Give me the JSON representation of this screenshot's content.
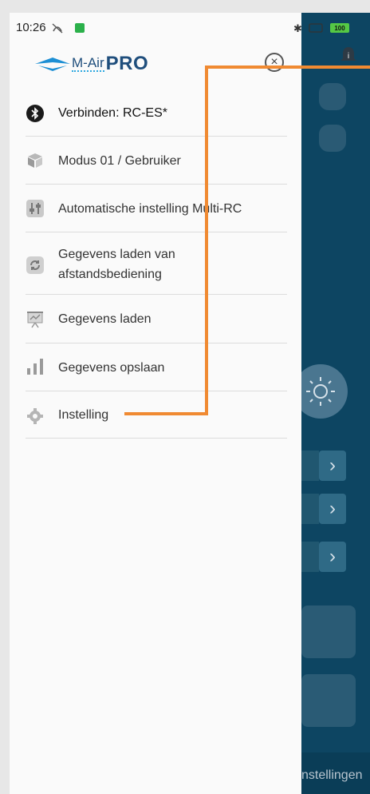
{
  "status_bar": {
    "time": "10:26",
    "battery": "100"
  },
  "drawer": {
    "logo": {
      "brand": "M-Air",
      "suffix": "PRO"
    },
    "items": [
      {
        "label": "Verbinden: RC-ES*",
        "icon": "bluetooth-icon"
      },
      {
        "label": "Modus 01 / Gebruiker",
        "icon": "cube-icon"
      },
      {
        "label": "Automatische instelling Multi-RC",
        "icon": "sliders-icon"
      },
      {
        "label": "Gegevens laden van",
        "label2": "afstandsbediening",
        "icon": "sync-icon"
      },
      {
        "label": "Gegevens laden",
        "icon": "presentation-chart-icon"
      },
      {
        "label": "Gegevens opslaan",
        "icon": "bar-chart-icon"
      },
      {
        "label": "Instelling",
        "icon": "gear-icon"
      }
    ]
  },
  "background_app": {
    "bottom_label": "nstellingen"
  },
  "colors": {
    "accent": "#f08a32",
    "app_bg": "#0d4562",
    "brand": "#1f4e7c"
  }
}
